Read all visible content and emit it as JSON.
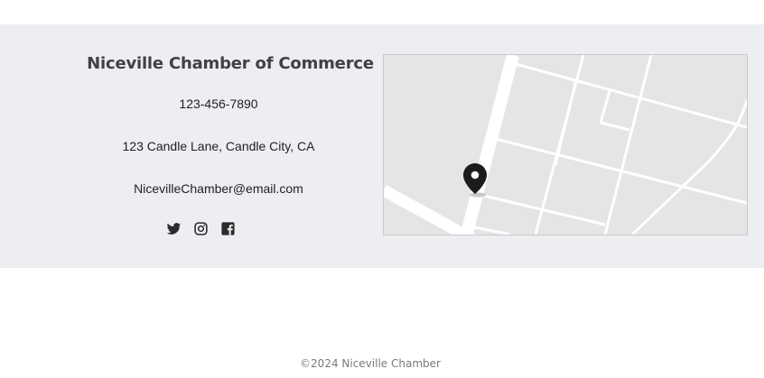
{
  "contact": {
    "org_name": "Niceville Chamber of Commerce",
    "phone": "123-456-7890",
    "address": "123 Candle Lane, Candle City, CA",
    "email": "NicevilleChamber@email.com"
  },
  "social": {
    "items": [
      {
        "icon": "twitter-icon"
      },
      {
        "icon": "instagram-icon"
      },
      {
        "icon": "facebook-icon"
      }
    ]
  },
  "map": {
    "marker_icon": "map-pin-icon"
  },
  "footer": {
    "copyright": "©2024 Niceville  Chamber"
  },
  "colors": {
    "band_background": "#edeef1",
    "title_text": "#3f4048",
    "map_background": "#e5e5e5",
    "map_roads": "#ffffff",
    "icon_color": "#2b2b2b"
  }
}
